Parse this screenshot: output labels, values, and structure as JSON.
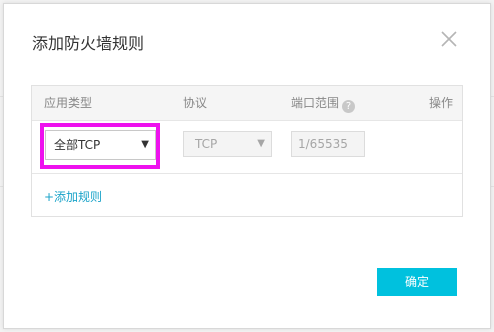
{
  "dialog": {
    "title": "添加防火墙规则",
    "close_icon": "close-icon"
  },
  "table": {
    "headers": {
      "app_type": "应用类型",
      "protocol": "协议",
      "port_range": "端口范围",
      "help_icon_glyph": "?",
      "action": "操作"
    },
    "row": {
      "app_type_value": "全部TCP",
      "app_type_caret": "▼",
      "protocol_value": "TCP",
      "protocol_caret": "▼",
      "port_range_value": "1/65535"
    },
    "add_rule_label": "+添加规则"
  },
  "footer": {
    "confirm_label": "确定"
  },
  "colors": {
    "accent": "#00c1de",
    "link": "#1aa3c9",
    "highlight": "#ee11ee"
  }
}
